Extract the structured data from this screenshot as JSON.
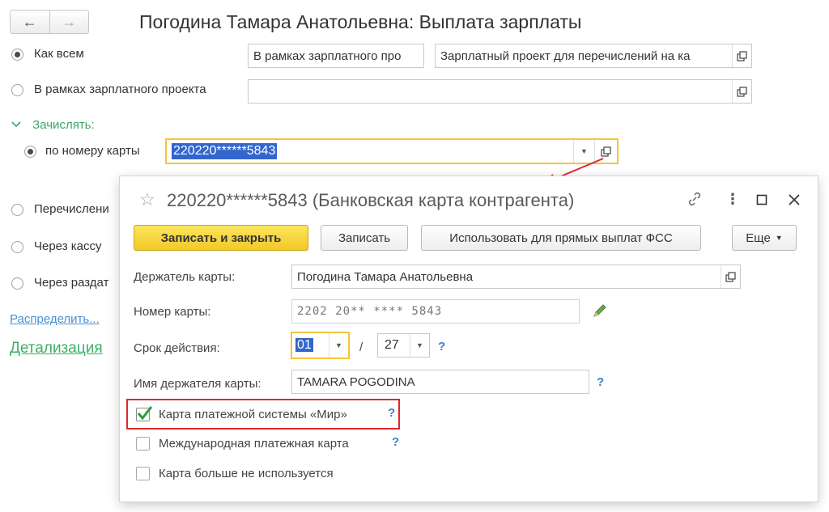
{
  "window": {
    "title": "Погодина Тамара Анатольевна: Выплата зарплаты"
  },
  "nav": {
    "back": "←",
    "forward": "→"
  },
  "options": {
    "like_all": {
      "label": "Как всем",
      "selected": true
    },
    "salary_project": {
      "label": "В рамках зарплатного проекта",
      "selected": false
    },
    "like_all_field_1": "В рамках зарплатного про",
    "like_all_field_2": "Зарплатный проект для перечислений на ка",
    "salary_project_field": ""
  },
  "accrue": {
    "header": "Зачислять:",
    "by_card": {
      "label": "по номеру карты",
      "selected": true,
      "value": "220220******5843"
    },
    "transfer_label": "Перечислени",
    "cash_label": "Через кассу",
    "distributor_label": "Через раздат"
  },
  "links": {
    "distribute": "Распределить...",
    "details": "Детализация"
  },
  "dialog": {
    "title": "220220******5843 (Банковская карта контрагента)",
    "buttons": {
      "save_close": "Записать и закрыть",
      "save": "Записать",
      "use_fss": "Использовать для прямых выплат ФСС",
      "more": "Еще"
    },
    "holder": {
      "label": "Держатель карты:",
      "value": "Погодина Тамара Анатольевна"
    },
    "card_number": {
      "label": "Номер карты:",
      "value": "2202 20** **** 5843"
    },
    "expiry": {
      "label": "Срок действия:",
      "month": "01",
      "sep": "/",
      "year": "27",
      "help": "?"
    },
    "holder_name": {
      "label": "Имя держателя карты:",
      "value": "TAMARA POGODINA",
      "help": "?"
    },
    "mir": {
      "label": "Карта платежной системы «Мир»",
      "checked": true,
      "help": "?"
    },
    "international": {
      "label": "Международная платежная карта",
      "checked": false,
      "help": "?"
    },
    "not_used": {
      "label": "Карта больше не используется",
      "checked": false
    }
  },
  "colors": {
    "accent_yellow": "#f3c638",
    "link_blue": "#4b8fd1",
    "green": "#3aa75f",
    "red_highlight": "#e0262b"
  }
}
